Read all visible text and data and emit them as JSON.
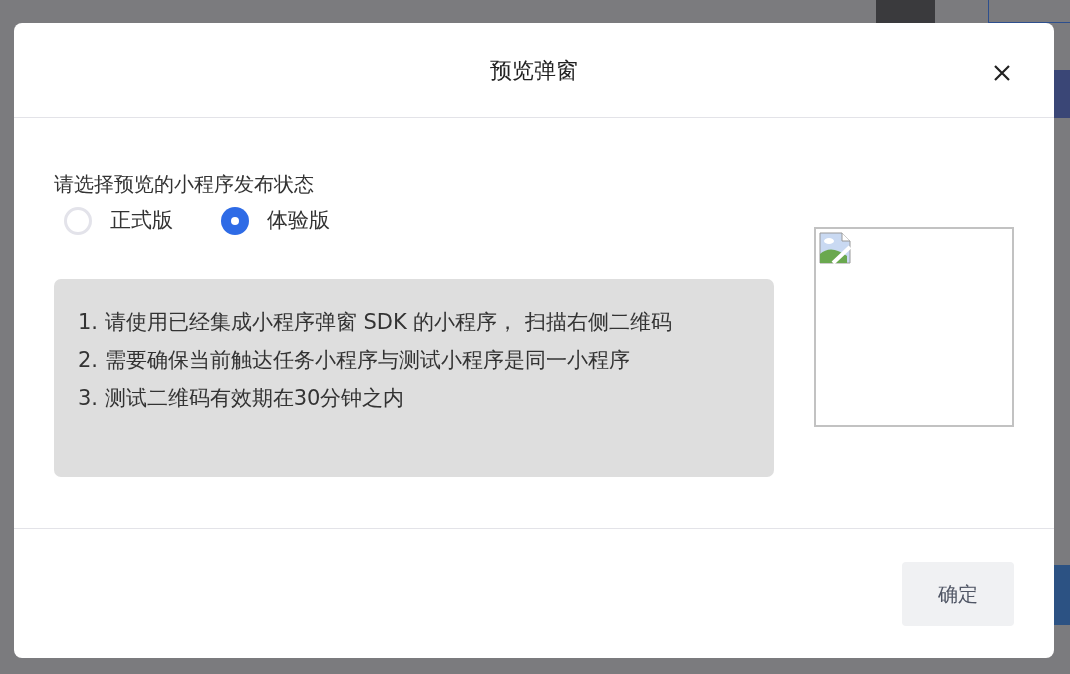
{
  "dialog": {
    "title": "预览弹窗",
    "prompt": "请选择预览的小程序发布状态",
    "options": [
      {
        "label": "正式版",
        "selected": false
      },
      {
        "label": "体验版",
        "selected": true
      }
    ],
    "instructions": [
      "1. 请使用已经集成小程序弹窗 SDK 的小程序， 扫描右侧二维码",
      "2. 需要确保当前触达任务小程序与测试小程序是同一小程序",
      "3. 测试二维码有效期在30分钟之内"
    ],
    "qr_code": {
      "kind": "broken-image"
    },
    "buttons": [
      "确定"
    ]
  }
}
